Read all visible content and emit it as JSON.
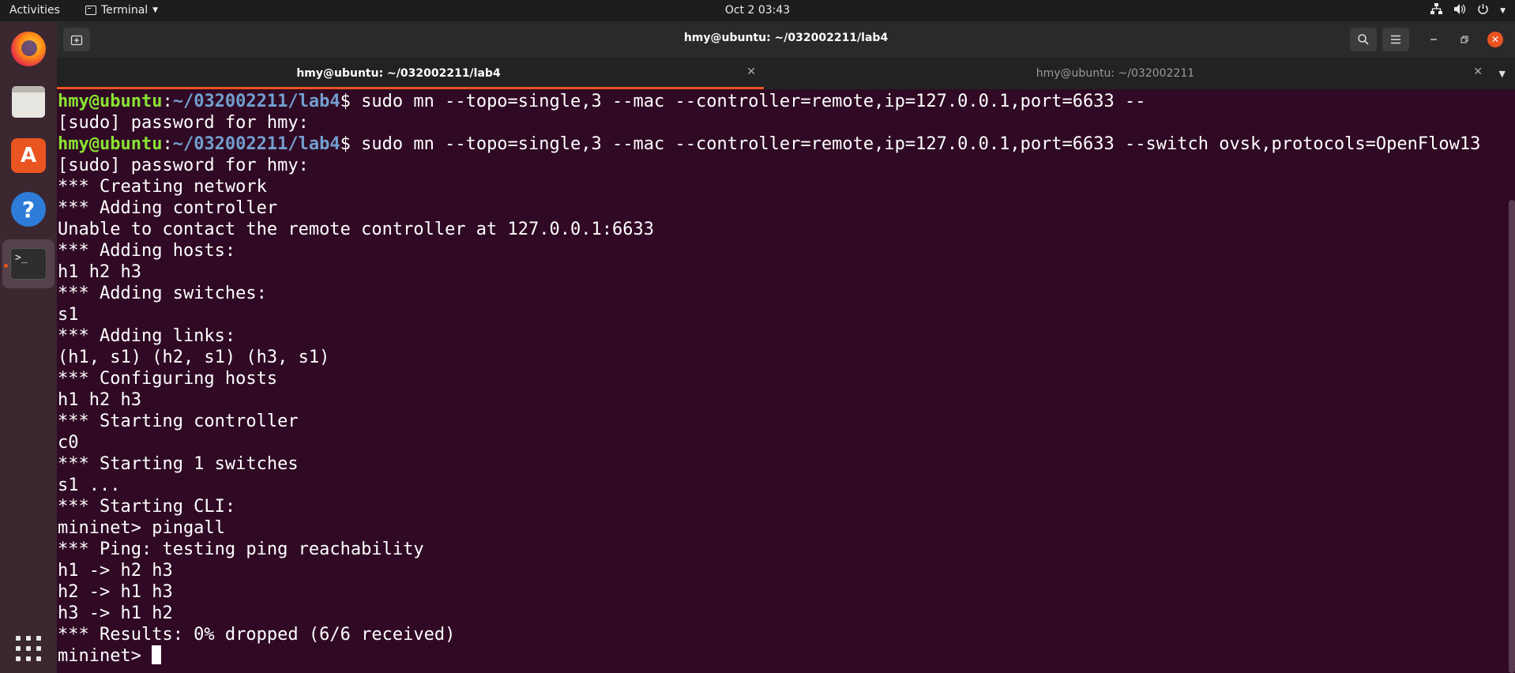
{
  "topbar": {
    "activities": "Activities",
    "app_menu": "Terminal",
    "clock": "Oct 2  03:43"
  },
  "window": {
    "title": "hmy@ubuntu: ~/032002211/lab4"
  },
  "tabs": [
    {
      "label": "hmy@ubuntu: ~/032002211/lab4",
      "active": true
    },
    {
      "label": "hmy@ubuntu: ~/032002211",
      "active": false
    }
  ],
  "prompt": {
    "user": "hmy@ubuntu",
    "sep": ":",
    "path": "~/032002211/lab4",
    "dollar": "$ "
  },
  "terminal": {
    "cmd1": "sudo mn --topo=single,3 --mac --controller=remote,ip=127.0.0.1,port=6633 --",
    "cmd2": "sudo mn --topo=single,3 --mac --controller=remote,ip=127.0.0.1,port=6633 --switch ovsk,protocols=OpenFlow13",
    "output_a": "[sudo] password for hmy:",
    "output_b": [
      "[sudo] password for hmy:",
      "*** Creating network",
      "*** Adding controller",
      "Unable to contact the remote controller at 127.0.0.1:6633",
      "*** Adding hosts:",
      "h1 h2 h3",
      "*** Adding switches:",
      "s1",
      "*** Adding links:",
      "(h1, s1) (h2, s1) (h3, s1)",
      "*** Configuring hosts",
      "h1 h2 h3",
      "*** Starting controller",
      "c0",
      "*** Starting 1 switches",
      "s1 ...",
      "*** Starting CLI:",
      "mininet> pingall",
      "*** Ping: testing ping reachability",
      "h1 -> h2 h3",
      "h2 -> h1 h3",
      "h3 -> h1 h2",
      "*** Results: 0% dropped (6/6 received)"
    ],
    "last_prompt": "mininet> "
  }
}
